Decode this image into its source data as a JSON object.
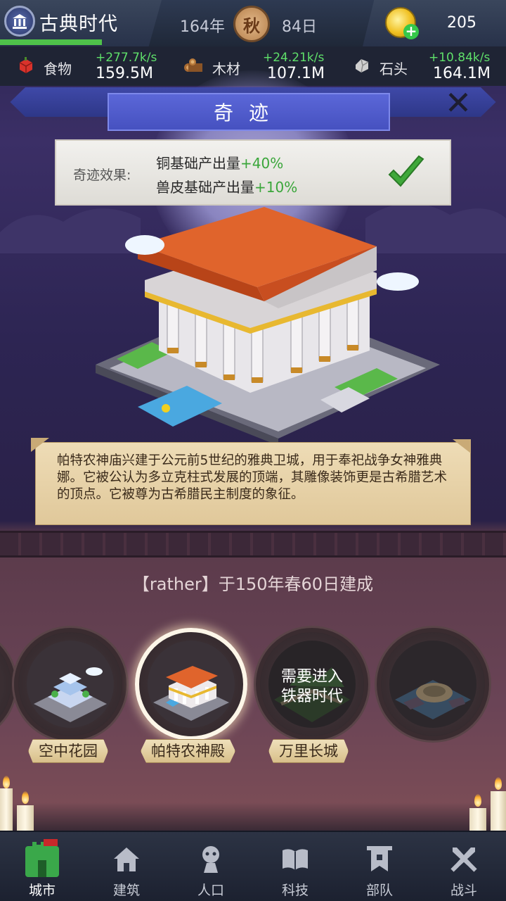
{
  "header": {
    "era_title": "古典时代",
    "year": "164年",
    "season": "秋",
    "day": "84日",
    "gold": "205"
  },
  "resources": [
    {
      "name": "食物",
      "rate": "+277.7k/s",
      "amount": "159.5M",
      "icon": "food-icon"
    },
    {
      "name": "木材",
      "rate": "+24.21k/s",
      "amount": "107.1M",
      "icon": "wood-icon"
    },
    {
      "name": "石头",
      "rate": "+10.84k/s",
      "amount": "164.1M",
      "icon": "stone-icon"
    }
  ],
  "wonder": {
    "title": "奇迹",
    "effect_label": "奇迹效果:",
    "effects": [
      {
        "text": "铜基础产出量",
        "value": "+40%"
      },
      {
        "text": "兽皮基础产出量",
        "value": "+10%"
      }
    ],
    "description": "帕特农神庙兴建于公元前5世纪的雅典卫城，用于奉祀战争女神雅典娜。它被公认为多立克柱式发展的顶端，其雕像装饰更是古希腊艺术的顶点。它被尊为古希腊民主制度的象征。",
    "built_info": "【rather】于150年春60日建成"
  },
  "wonder_list": [
    {
      "name": "空中花园",
      "selected": false,
      "locked_text": ""
    },
    {
      "name": "帕特农神殿",
      "selected": true,
      "locked_text": ""
    },
    {
      "name": "万里长城",
      "selected": false,
      "locked_text": "需要进入铁器时代"
    },
    {
      "name": "",
      "selected": false,
      "locked_text": ""
    }
  ],
  "locked": {
    "line1": "需要进入",
    "line2": "铁器时代"
  },
  "nav": [
    {
      "label": "城市",
      "icon": "castle-icon",
      "active": true
    },
    {
      "label": "建筑",
      "icon": "house-icon",
      "active": false
    },
    {
      "label": "人口",
      "icon": "person-icon",
      "active": false
    },
    {
      "label": "科技",
      "icon": "book-icon",
      "active": false
    },
    {
      "label": "部队",
      "icon": "banner-icon",
      "active": false
    },
    {
      "label": "战斗",
      "icon": "swords-icon",
      "active": false
    }
  ],
  "colors": {
    "accent_green": "#5fe06a",
    "title_blue": "#4651c0",
    "effect_green": "#3aa63a"
  }
}
